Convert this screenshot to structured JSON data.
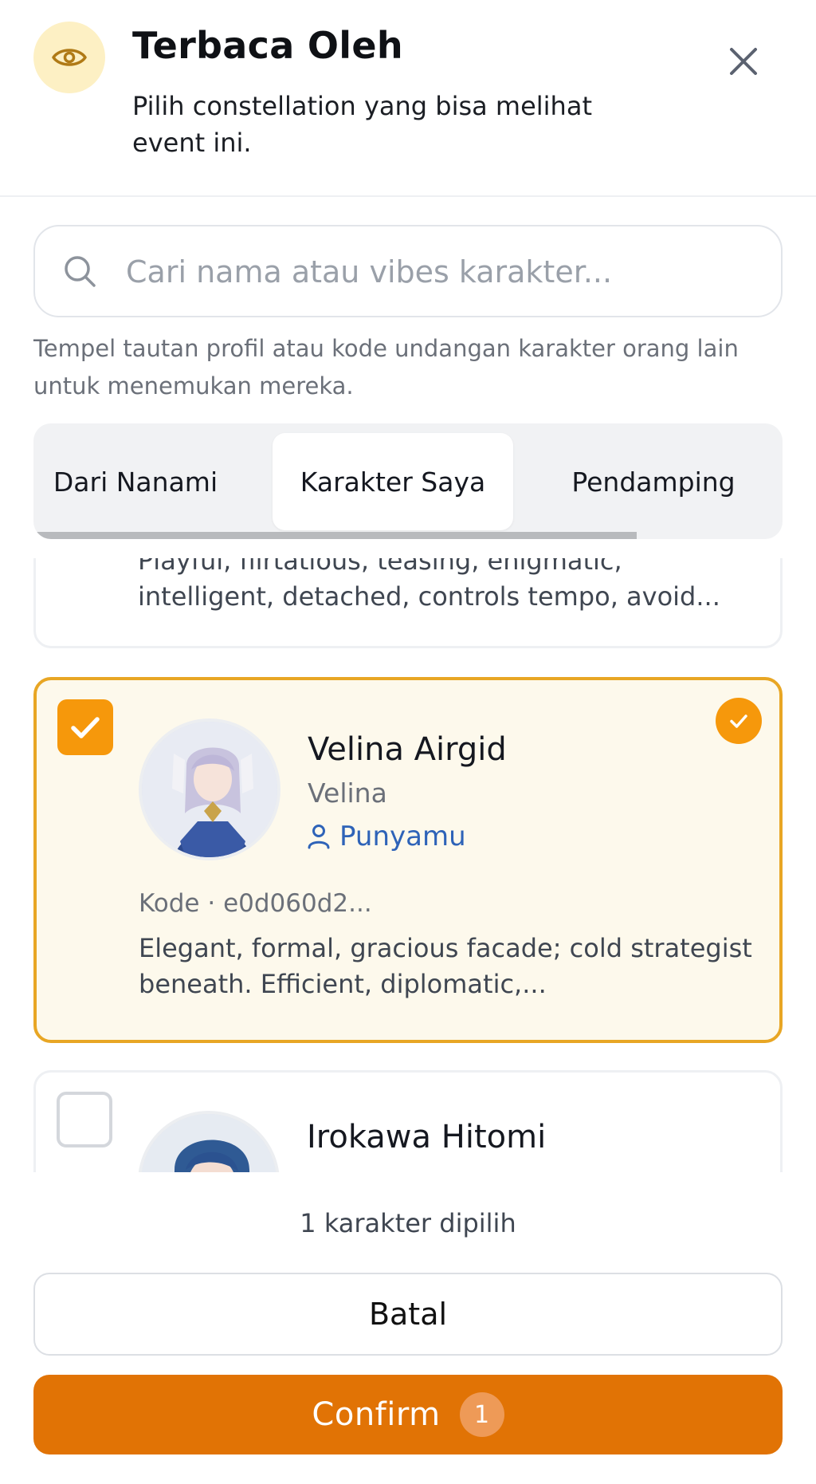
{
  "header": {
    "title": "Terbaca Oleh",
    "subtitle": "Pilih constellation yang bisa melihat event ini.",
    "icon": "eye-icon",
    "close_icon": "close-icon"
  },
  "search": {
    "placeholder": "Cari nama atau vibes karakter...",
    "value": "",
    "hint": "Tempel tautan profil atau kode undangan karakter orang lain untuk menemukan mereka."
  },
  "tabs": [
    {
      "label": "Dari Nanami",
      "active": false
    },
    {
      "label": "Karakter Saya",
      "active": true
    },
    {
      "label": "Pendamping",
      "active": false
    }
  ],
  "characters": [
    {
      "description": "Playful, flirtatious, teasing, enigmatic, intelligent, detached, controls tempo, avoid..."
    },
    {
      "name": "Velina Airgid",
      "alias": "Velina",
      "owner_label": "Punyamu",
      "code": "Kode · e0d060d2...",
      "description": "Elegant, formal, gracious facade; cold strategist beneath. Efficient, diplomatic,...",
      "selected": true
    },
    {
      "name": "Irokawa Hitomi",
      "selected": false
    }
  ],
  "footer": {
    "selected_count": "1 karakter dipilih",
    "cancel_label": "Batal",
    "confirm_label": "Confirm",
    "confirm_badge": "1"
  },
  "colors": {
    "accent": "#e17305",
    "selected_border": "#e8a624",
    "selected_bg": "#fdf9ec",
    "checkbox_on": "#f6980b",
    "owner_link": "#2e63b8"
  }
}
